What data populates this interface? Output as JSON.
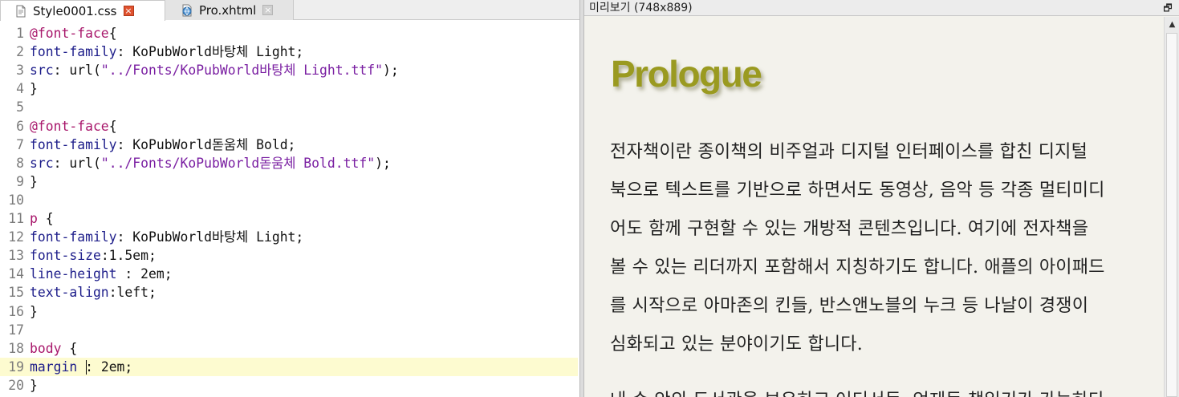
{
  "tabs": [
    {
      "label": "Style0001.css",
      "icon": "css-file-icon",
      "close": "×"
    },
    {
      "label": "Pro.xhtml",
      "icon": "xhtml-file-icon",
      "close": "×"
    }
  ],
  "code_lines": [
    {
      "num": "1",
      "parts": [
        [
          "at",
          "@font-face"
        ],
        [
          "punct",
          "{"
        ]
      ]
    },
    {
      "num": "2",
      "parts": [
        [
          "prop",
          "font-family"
        ],
        [
          "punct",
          ": KoPubWorld바탕체 Light;"
        ]
      ]
    },
    {
      "num": "3",
      "parts": [
        [
          "prop",
          "src"
        ],
        [
          "punct",
          ": url("
        ],
        [
          "str",
          "\"../Fonts/KoPubWorld바탕체 Light.ttf\""
        ],
        [
          "punct",
          ");"
        ]
      ]
    },
    {
      "num": "4",
      "parts": [
        [
          "punct",
          "}"
        ]
      ]
    },
    {
      "num": "5",
      "parts": []
    },
    {
      "num": "6",
      "parts": [
        [
          "at",
          "@font-face"
        ],
        [
          "punct",
          "{"
        ]
      ]
    },
    {
      "num": "7",
      "parts": [
        [
          "prop",
          "font-family"
        ],
        [
          "punct",
          ": KoPubWorld돋움체 Bold;"
        ]
      ]
    },
    {
      "num": "8",
      "parts": [
        [
          "prop",
          "src"
        ],
        [
          "punct",
          ": url("
        ],
        [
          "str",
          "\"../Fonts/KoPubWorld돋움체 Bold.ttf\""
        ],
        [
          "punct",
          ");"
        ]
      ]
    },
    {
      "num": "9",
      "parts": [
        [
          "punct",
          "}"
        ]
      ]
    },
    {
      "num": "10",
      "parts": []
    },
    {
      "num": "11",
      "parts": [
        [
          "sel",
          "p"
        ],
        [
          "punct",
          " {"
        ]
      ]
    },
    {
      "num": "12",
      "parts": [
        [
          "prop",
          "font-family"
        ],
        [
          "punct",
          ": KoPubWorld바탕체 Light;"
        ]
      ]
    },
    {
      "num": "13",
      "parts": [
        [
          "prop",
          "font-size"
        ],
        [
          "punct",
          ":1.5em;"
        ]
      ]
    },
    {
      "num": "14",
      "parts": [
        [
          "prop",
          "line-height"
        ],
        [
          "punct",
          " : 2em;"
        ]
      ]
    },
    {
      "num": "15",
      "parts": [
        [
          "prop",
          "text-align"
        ],
        [
          "punct",
          ":left;"
        ]
      ]
    },
    {
      "num": "16",
      "parts": [
        [
          "punct",
          "}"
        ]
      ]
    },
    {
      "num": "17",
      "parts": []
    },
    {
      "num": "18",
      "parts": [
        [
          "sel",
          "body"
        ],
        [
          "punct",
          " {"
        ]
      ]
    },
    {
      "num": "19",
      "parts": [
        [
          "prop",
          "margin"
        ],
        [
          "punct",
          " : 2em;"
        ]
      ]
    },
    {
      "num": "20",
      "parts": [
        [
          "punct",
          "}"
        ]
      ]
    }
  ],
  "current_line": "19",
  "preview": {
    "header": "미리보기 (748x889)",
    "restore_icon": "🗗",
    "title": "Prologue",
    "paragraph_lines": [
      "전자책이란 종이책의 비주얼과 디지털 인터페이스를 합친 디지털",
      "북으로 텍스트를 기반으로 하면서도 동영상, 음악 등 각종 멀티미디",
      "어도 함께 구현할 수 있는 개방적 콘텐츠입니다. 여기에 전자책을",
      "볼 수 있는 리더까지 포함해서 지칭하기도 합니다. 애플의 아이패드",
      "를 시작으로 아마존의 킨들, 반스앤노블의 누크 등 나날이 경쟁이",
      "심화되고 있는 분야이기도 합니다.",
      "내 손 안의 도서관을 보유하고 어디서든, 언제든 책읽기가 가능하다"
    ]
  },
  "colors": {
    "title": "#9a9a20",
    "current_line_bg": "#fdfbd0",
    "preview_bg": "#f3f2ec"
  }
}
